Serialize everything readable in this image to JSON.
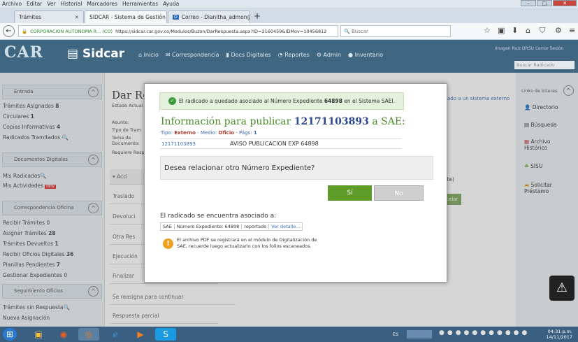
{
  "menubar": [
    "Archivo",
    "Editar",
    "Ver",
    "Historial",
    "Marcadores",
    "Herramientas",
    "Ayuda"
  ],
  "tabs": [
    {
      "label": "Trámites"
    },
    {
      "label": "SIDCAR - Sistema de Gestión Doc"
    },
    {
      "label": "Correo - Dianitha_admon@"
    }
  ],
  "navbar": {
    "site": "CORPORACION AUTONOMA R... (CO)",
    "url": "https://sidcar.car.gov.co/Modulos/Buzon/DarRespuesta.aspx?ID=2160459&IDMov=10456812",
    "search_placeholder": "Buscar"
  },
  "header": {
    "logo": "CAR",
    "app": "Sidcar",
    "nav": [
      "Inicio",
      "Correspondencia",
      "Docs Digitales",
      "Reportes",
      "Admin",
      "Inventario"
    ],
    "user": "Imagen Ruiz  DRSU  Cerrar Sesión",
    "search_placeholder": "Buscar Radicado"
  },
  "sidebar": {
    "sec1": "Entrada",
    "items1": [
      {
        "label": "Trámites Asignados ",
        "count": "8"
      },
      {
        "label": "Circulares ",
        "count": "1"
      },
      {
        "label": "Copias Informativas ",
        "count": "4"
      },
      {
        "label": "Radicados Tramitados ",
        "count": ""
      }
    ],
    "sec2": "Documentos Digitales",
    "items2": [
      {
        "label": "Mis Radicados",
        "count": ""
      },
      {
        "label": "Mis Actividades",
        "count": ""
      }
    ],
    "sec3": "Correspondencia Oficina",
    "items3": [
      {
        "label": "Recibir Trámites ",
        "count": "0"
      },
      {
        "label": "Asignar Trámites ",
        "count": "28"
      },
      {
        "label": "Trámites Devueltos ",
        "count": "1"
      },
      {
        "label": "Recibir Oficios Digitales ",
        "count": "36"
      },
      {
        "label": "Planillas Pendientes ",
        "count": "7"
      },
      {
        "label": "Gestionar Expedientes ",
        "count": "0"
      }
    ],
    "sec4": "Seguimiento Oficios",
    "items4": [
      {
        "label": "Trámites sin Respuesta",
        "count": ""
      },
      {
        "label": "Nueva Asignación",
        "count": ""
      }
    ]
  },
  "main": {
    "title": "Dar Res",
    "estado": "Estado Actual",
    "asunto": "Asunto:",
    "tipo": "Tipo de Tram",
    "tema": "Tema de Documento:",
    "requiere": "Requiere Resp",
    "rows": [
      "Traslado",
      "Devoluci",
      "Otra Res",
      "Ejecución",
      "Finalizar",
      "Se reasigna para continuar",
      "Respuesta parcial"
    ],
    "extlink": "ado a un sistema externo",
    "mite": "mite)",
    "cancel": "Cancelar"
  },
  "right": {
    "title": "Links de Interes",
    "items": [
      "Directorio",
      "Búsqueda",
      "Archivo Histórico",
      "SISU",
      "Solicitar Préstamo"
    ]
  },
  "modal": {
    "success_pre": "El radicado a quedado asociado al Número Expediente ",
    "success_num": "64898",
    "success_post": " en el Sistema SAEI.",
    "title_pre": "Información para publicar ",
    "title_num": "12171103893",
    "title_post": " a SAE:",
    "sub_tipo_label": "Tipo: ",
    "sub_tipo": "Externo",
    "sub_medio_label": " - Medio: ",
    "sub_medio": "Oficio",
    "sub_pags_label": " - Págs: ",
    "sub_pags": "1",
    "rad_id": "12171103893",
    "rad_desc": "AVISO PUBLICACION EXP 64898",
    "question": "Desea relacionar otro Número Expediente?",
    "btn_si": "Sí",
    "btn_no": "No",
    "assoc_label": "El radicado se encuentra asociado a:",
    "assoc": [
      "SAE",
      "Número Expediente: 64898",
      "reportado",
      "Ver detalle..."
    ],
    "note": "El archivo PDF se registrará en el módulo de Digitalización de SAE, recuerde luego actualizarlo con los folios escaneados."
  },
  "taskbar": {
    "lang": "ES",
    "time": "04:31 p.m.",
    "date": "14/11/2017"
  }
}
